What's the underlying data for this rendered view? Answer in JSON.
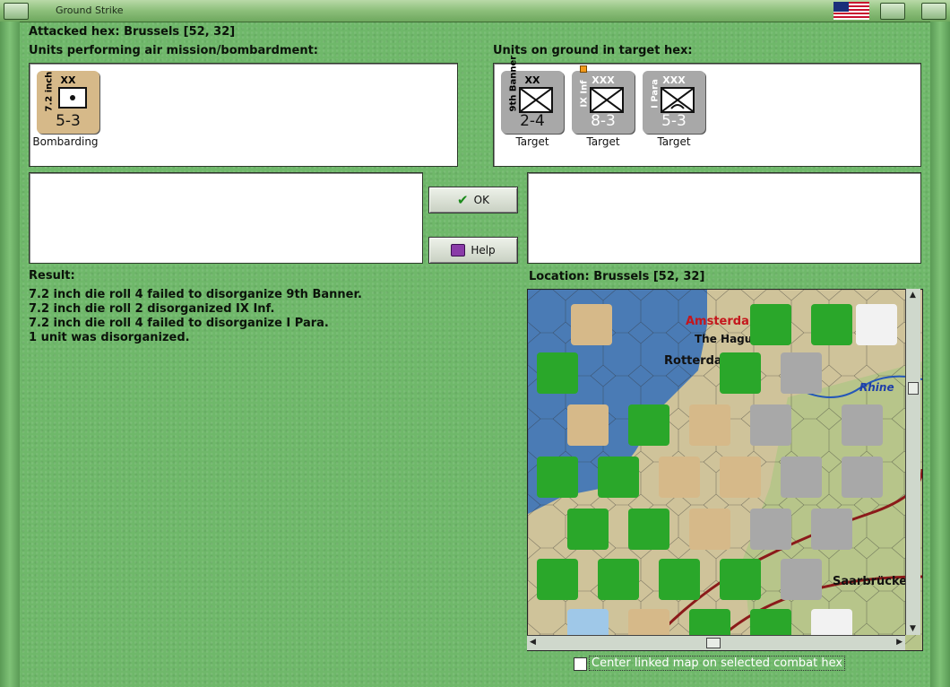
{
  "window": {
    "title": "Ground Strike"
  },
  "header": {
    "attacked_hex": "Attacked hex: Brussels  [52, 32]",
    "air_units_label": "Units performing air mission/bombardment:",
    "ground_units_label": "Units on ground in target hex:"
  },
  "air_units": [
    {
      "name": "7.2 inch",
      "size": "XX",
      "strength": "5-3",
      "status": "Bombarding"
    }
  ],
  "ground_units": [
    {
      "name": "9th Banner",
      "size": "XX",
      "strength": "2-4",
      "status": "Target"
    },
    {
      "name": "IX Inf",
      "size": "XXX",
      "strength": "8-3",
      "status": "Target"
    },
    {
      "name": "I Para",
      "size": "XXX",
      "strength": "5-3",
      "status": "Target"
    }
  ],
  "buttons": {
    "ok": "OK",
    "help": "Help"
  },
  "result": {
    "label": "Result:",
    "lines": [
      "7.2 inch die roll 4 failed to disorganize 9th Banner.",
      "7.2 inch die roll 2 disorganized IX Inf.",
      "7.2 inch die roll 4 failed to disorganize I Para.",
      "1 unit was disorganized."
    ]
  },
  "location": {
    "label": "Location:  Brussels  [52, 32]"
  },
  "map_labels": {
    "amsterdam": "Amsterdam",
    "the_hague": "The Hague",
    "rotterdam": "Rotterdam",
    "rhine": "Rhine",
    "saarbrucken": "Saarbrücken"
  },
  "options": {
    "center_map": "Center linked map on selected combat hex"
  },
  "colors": {
    "background": "#6fb86a",
    "allied_counter": "#d6b989",
    "axis_counter": "#a8a8a8"
  }
}
